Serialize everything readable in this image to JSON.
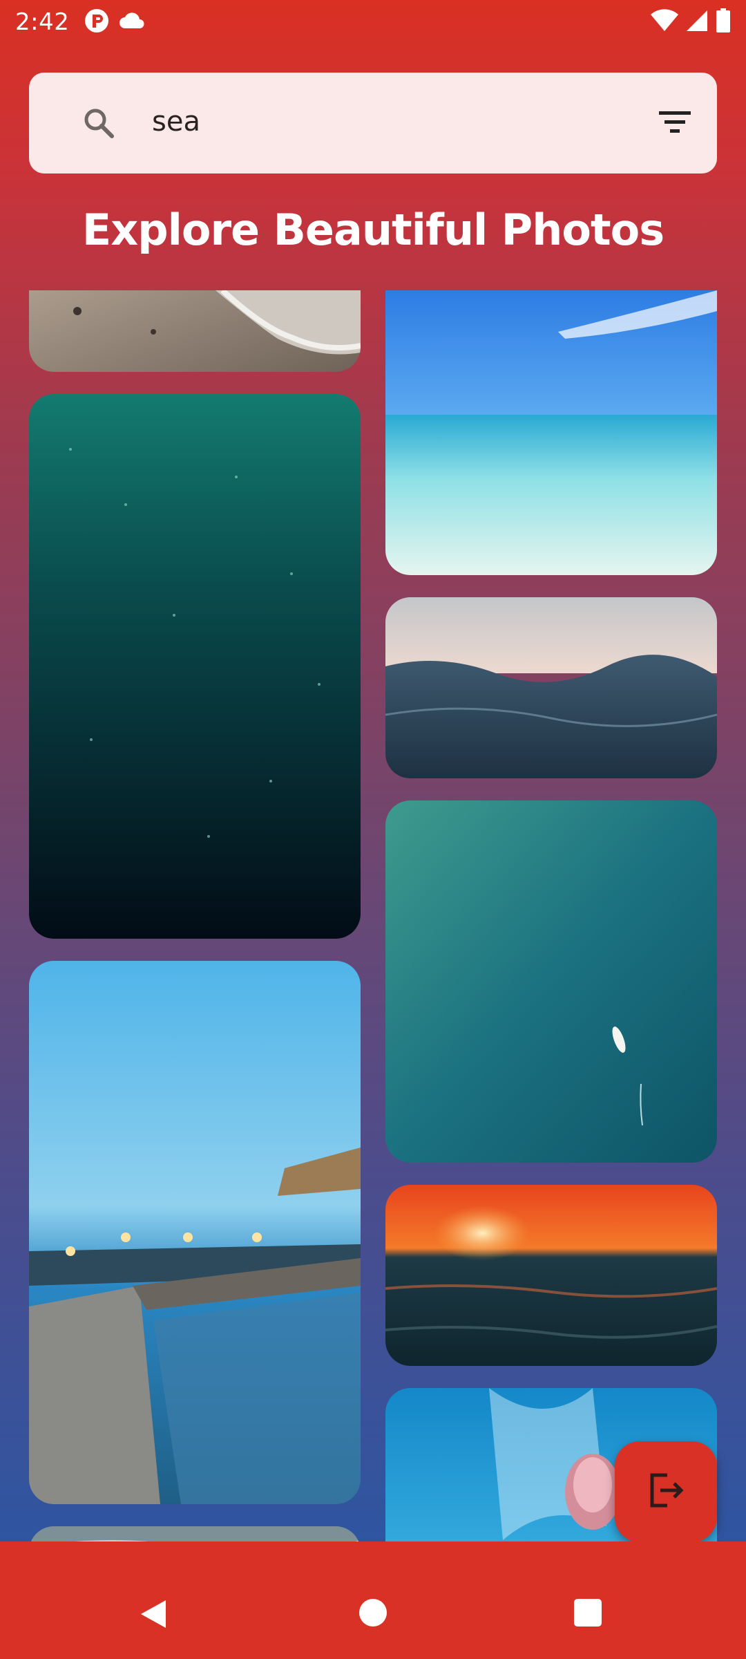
{
  "status_bar": {
    "time": "2:42",
    "icons": [
      "app-notification-icon",
      "cloud-icon",
      "wifi-icon",
      "signal-icon",
      "battery-icon"
    ]
  },
  "search": {
    "query": "sea",
    "search_icon": "search-icon",
    "filter_icon": "filter-icon"
  },
  "header": {
    "title": "Explore Beautiful Photos"
  },
  "photos": [
    {
      "subject": "sandy beach with wave foam"
    },
    {
      "subject": "underwater deep teal sea"
    },
    {
      "subject": "wooden pier at dusk with lights"
    },
    {
      "subject": "partial photo"
    },
    {
      "subject": "turquoise tropical sea and sky"
    },
    {
      "subject": "ocean waves at dawn"
    },
    {
      "subject": "aerial teal sea with small boat"
    },
    {
      "subject": "orange sunset over sea"
    },
    {
      "subject": "jellyfish in blue water"
    }
  ],
  "fab": {
    "icon": "logout-icon"
  },
  "nav": {
    "back_icon": "back-icon",
    "home_icon": "home-icon",
    "recents_icon": "recents-icon"
  },
  "colors": {
    "primary": "#d93125",
    "search_bg": "#fae9e8",
    "gradient_bottom": "#2f55a1"
  }
}
